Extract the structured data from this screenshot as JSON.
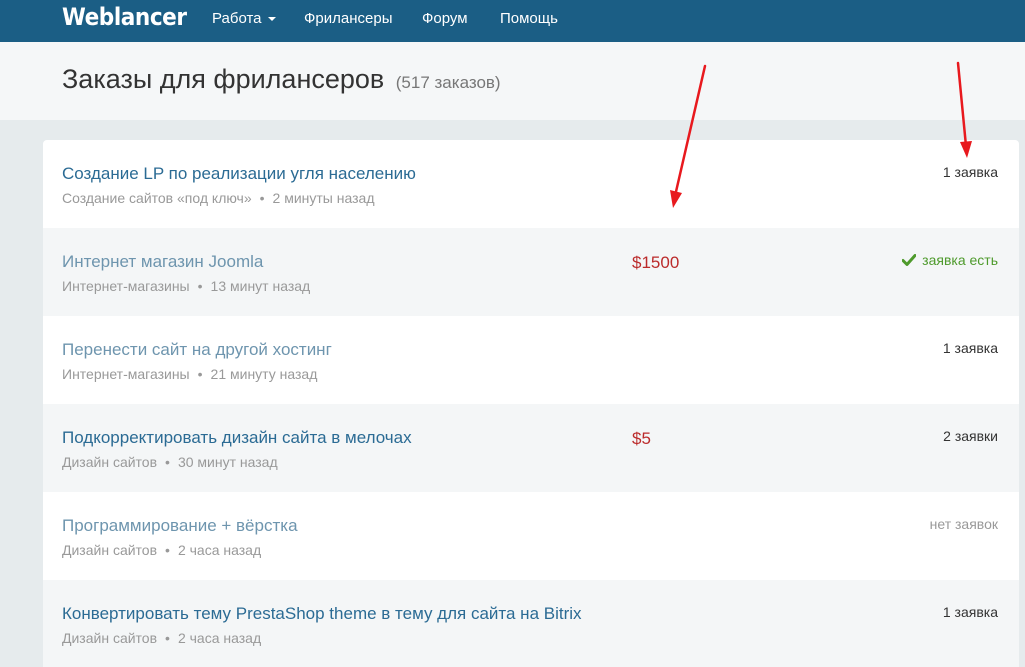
{
  "navbar": {
    "brand": "Weblancer",
    "items": [
      {
        "label": "Работа"
      },
      {
        "label": "Фрилансеры"
      },
      {
        "label": "Форум"
      },
      {
        "label": "Помощь"
      }
    ]
  },
  "header": {
    "title": "Заказы для фрилансеров",
    "count": "(517 заказов)"
  },
  "orders": [
    {
      "title": "Создание LP по реализации угля населению",
      "category": "Создание сайтов «под ключ»",
      "time": "2 минуты назад",
      "price": "",
      "bids": "1 заявка"
    },
    {
      "title": "Интернет магазин Joomla",
      "category": "Интернет-магазины",
      "time": "13 минут назад",
      "price": "$1500",
      "bids": "заявка есть"
    },
    {
      "title": "Перенести сайт на другой хостинг",
      "category": "Интернет-магазины",
      "time": "21 минуту назад",
      "price": "",
      "bids": "1 заявка"
    },
    {
      "title": "Подкорректировать дизайн сайта в мелочах",
      "category": "Дизайн сайтов",
      "time": "30 минут назад",
      "price": "$5",
      "bids": "2 заявки"
    },
    {
      "title": "Программирование + вёрстка",
      "category": "Дизайн сайтов",
      "time": "2 часа назад",
      "price": "",
      "bids": "нет заявок"
    },
    {
      "title": "Конвертировать тему PrestaShop theme в тему для сайта на Bitrix",
      "category": "Дизайн сайтов",
      "time": "2 часа назад",
      "price": "",
      "bids": "1 заявка"
    }
  ],
  "colors": {
    "navbar": "#1b5e85",
    "link": "#2b6b94",
    "visited_link": "#6e95ae",
    "price": "#bb2b2b",
    "bid_ok": "#4e9a2c",
    "annotation_arrow": "#e8191e"
  }
}
